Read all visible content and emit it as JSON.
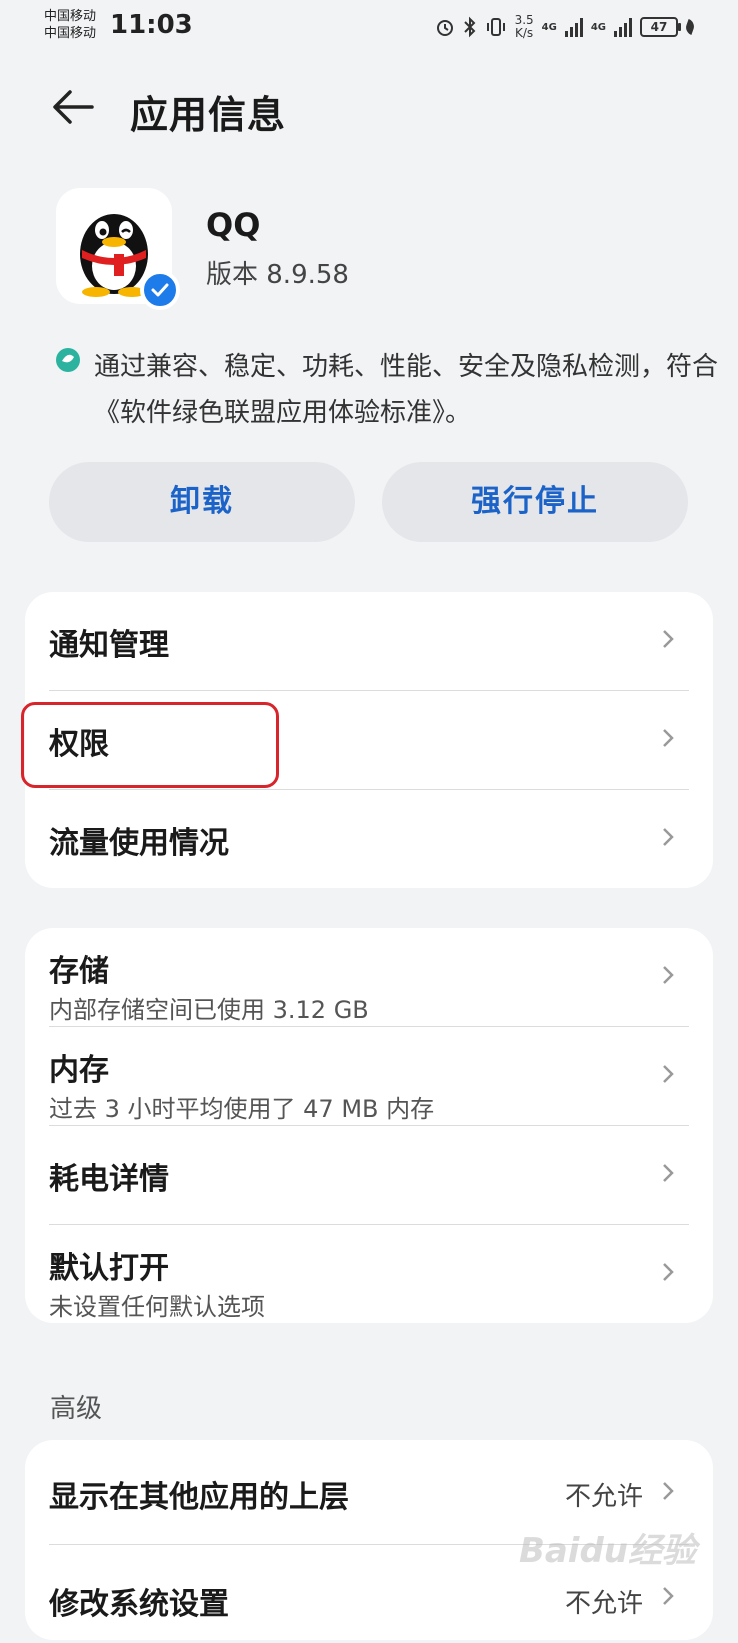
{
  "status_bar": {
    "carrier_1": "中国移动",
    "carrier_2": "中国移动",
    "time": "11:03",
    "speed_value": "3.5",
    "speed_unit": "K/s",
    "network_1": "4G",
    "network_2": "4G",
    "battery": "47"
  },
  "header": {
    "title": "应用信息"
  },
  "app": {
    "name": "QQ",
    "version": "版本 8.9.58",
    "certification": "通过兼容、稳定、功耗、性能、安全及隐私检测，符合《软件绿色联盟应用体验标准》。"
  },
  "actions": {
    "uninstall": "卸载",
    "force_stop": "强行停止"
  },
  "group1": [
    {
      "title": "通知管理"
    },
    {
      "title": "权限"
    },
    {
      "title": "流量使用情况"
    }
  ],
  "group2": [
    {
      "title": "存储",
      "subtitle": "内部存储空间已使用 3.12 GB"
    },
    {
      "title": "内存",
      "subtitle": "过去 3 小时平均使用了 47 MB 内存"
    },
    {
      "title": "耗电详情"
    },
    {
      "title": "默认打开",
      "subtitle": "未设置任何默认选项"
    }
  ],
  "advanced": {
    "label": "高级",
    "items": [
      {
        "title": "显示在其他应用的上层",
        "value": "不允许"
      },
      {
        "title": "修改系统设置",
        "value": "不允许"
      }
    ]
  },
  "watermark": "Baidu经验",
  "colors": {
    "accent": "#1b63c8",
    "highlight": "#d8242b",
    "background": "#f1f3f5"
  }
}
